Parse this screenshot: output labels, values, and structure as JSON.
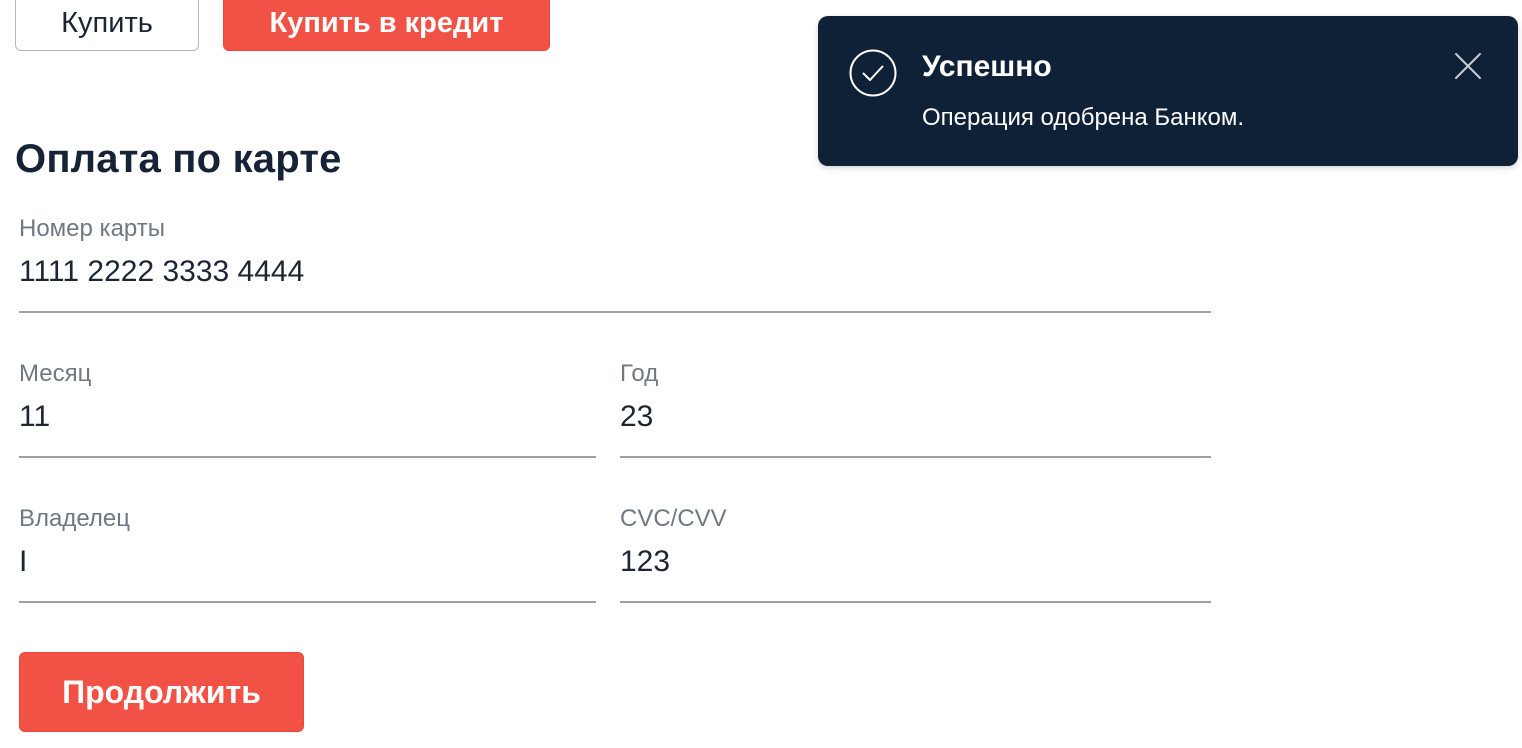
{
  "top_buttons": {
    "buy_label": "Купить",
    "credit_label": "Купить в кредит"
  },
  "form": {
    "title": "Оплата по карте",
    "card_number": {
      "label": "Номер карты",
      "value": "1111 2222 3333 4444"
    },
    "month": {
      "label": "Месяц",
      "value": "11"
    },
    "year": {
      "label": "Год",
      "value": "23"
    },
    "owner": {
      "label": "Владелец",
      "value": "I"
    },
    "cvc": {
      "label": "CVC/CVV",
      "value": "123"
    },
    "continue_label": "Продолжить"
  },
  "notification": {
    "title": "Успешно",
    "message": "Операция одобрена Банком.",
    "status_icon": "check-circle-icon",
    "close_icon": "close-icon"
  },
  "colors": {
    "accent": "#f25246",
    "toast_bg": "#0f2137",
    "text": "#1b2533",
    "label": "#6f7883"
  }
}
